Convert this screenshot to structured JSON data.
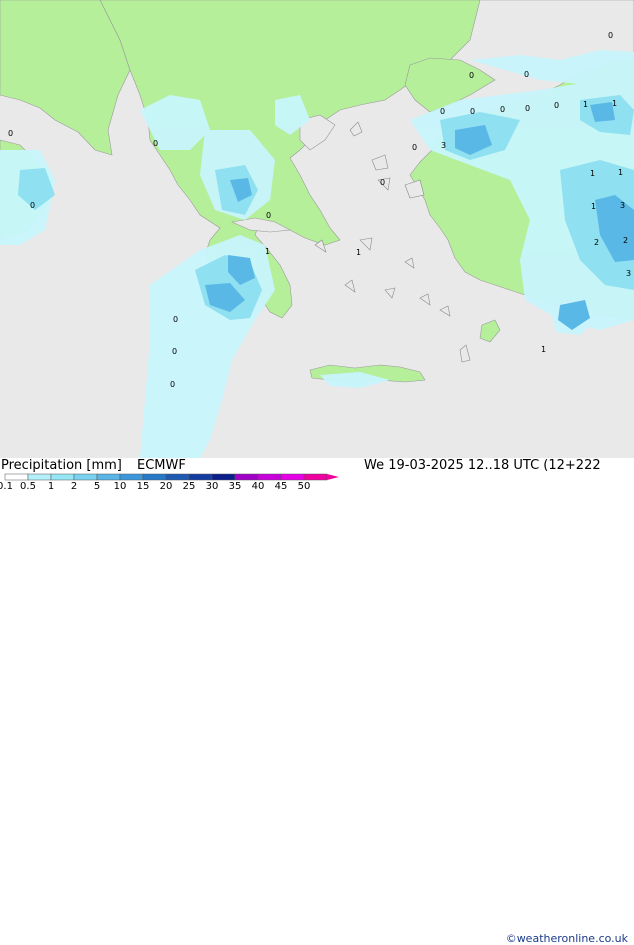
{
  "title": {
    "label": "Precipitation [mm]",
    "model": "ECMWF",
    "validity": "We 19-03-2025 12..18 UTC (12+222",
    "credit": "©weatheronline.co.uk"
  },
  "legend": {
    "ticks": [
      "0.1",
      "0.5",
      "1",
      "2",
      "5",
      "10",
      "15",
      "20",
      "25",
      "30",
      "35",
      "40",
      "45",
      "50"
    ],
    "colors": [
      "#ffffff",
      "#b4f0fa",
      "#96e6f5",
      "#78d2f0",
      "#5ab4e6",
      "#3c96dc",
      "#2878c8",
      "#1e5ab4",
      "#143ca0",
      "#0a1e8c",
      "#a000c8",
      "#c800dc",
      "#e600e6",
      "#f000a0"
    ]
  },
  "colors": {
    "land": "#b5ef9a",
    "sea": "#e9e9e9",
    "precip_light": "#c8f5fc",
    "precip_mid": "#8fe0f0",
    "precip_heavy": "#5ab8e6"
  },
  "map_labels": [
    {
      "text": "0"
    },
    {
      "text": "0"
    },
    {
      "text": "0"
    },
    {
      "text": "0"
    },
    {
      "text": "0"
    },
    {
      "text": "0"
    },
    {
      "text": "0"
    },
    {
      "text": "0"
    },
    {
      "text": "0"
    },
    {
      "text": "0"
    },
    {
      "text": "1"
    },
    {
      "text": "1"
    },
    {
      "text": "1"
    },
    {
      "text": "1"
    },
    {
      "text": "1"
    },
    {
      "text": "1"
    },
    {
      "text": "2"
    },
    {
      "text": "2"
    },
    {
      "text": "3"
    },
    {
      "text": "3"
    },
    {
      "text": "3"
    },
    {
      "text": "0"
    },
    {
      "text": "0"
    },
    {
      "text": "0"
    },
    {
      "text": "0"
    },
    {
      "text": "0"
    },
    {
      "text": "0"
    },
    {
      "text": "0"
    },
    {
      "text": "1"
    },
    {
      "text": "1"
    }
  ]
}
